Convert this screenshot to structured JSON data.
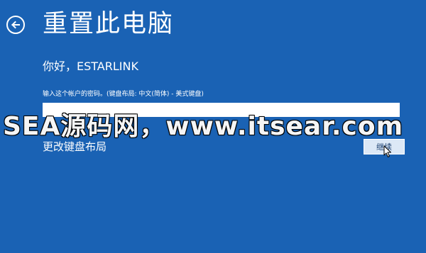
{
  "page": {
    "title": "重置此电脑",
    "greeting": "你好，ESTARLINK",
    "back_icon": "back-arrow-icon"
  },
  "password": {
    "label": "输入这个帐户的密码。(键盘布局: 中文(简体) - 美式键盘)",
    "value": ""
  },
  "actions": {
    "change_layout_label": "更改键盘布局",
    "continue_label": "继续"
  },
  "watermark": {
    "text": "SEA源码网，www.itsear.com"
  },
  "colors": {
    "background": "#1a62b4",
    "text": "#ffffff",
    "button_fill": "#dce8f6"
  }
}
